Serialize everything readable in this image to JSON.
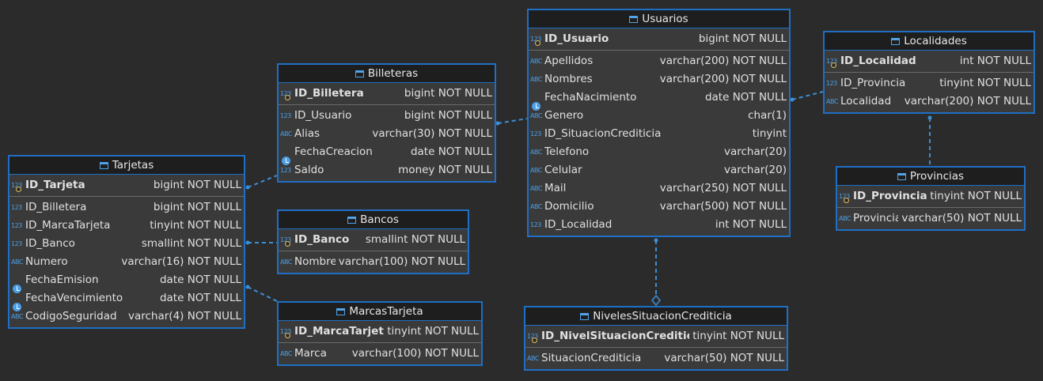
{
  "entities": {
    "usuarios": {
      "title": "Usuarios",
      "pk": {
        "name": "ID_Usuario",
        "type": "bigint NOT NULL",
        "icon": "123"
      },
      "columns": [
        {
          "name": "Apellidos",
          "type": "varchar(200) NOT NULL",
          "icon": "ABC"
        },
        {
          "name": "Nombres",
          "type": "varchar(200) NOT NULL",
          "icon": "ABC"
        },
        {
          "name": "FechaNacimiento",
          "type": "date NOT NULL",
          "icon": "date"
        },
        {
          "name": "Genero",
          "type": "char(1)",
          "icon": "ABC"
        },
        {
          "name": "ID_SituacionCrediticia",
          "type": "tinyint",
          "icon": "123"
        },
        {
          "name": "Telefono",
          "type": "varchar(20)",
          "icon": "ABC"
        },
        {
          "name": "Celular",
          "type": "varchar(20)",
          "icon": "ABC"
        },
        {
          "name": "Mail",
          "type": "varchar(250) NOT NULL",
          "icon": "ABC"
        },
        {
          "name": "Domicilio",
          "type": "varchar(500) NOT NULL",
          "icon": "ABC"
        },
        {
          "name": "ID_Localidad",
          "type": "int NOT NULL",
          "icon": "123"
        }
      ]
    },
    "localidades": {
      "title": "Localidades",
      "pk": {
        "name": "ID_Localidad",
        "type": "int NOT NULL",
        "icon": "123"
      },
      "columns": [
        {
          "name": "ID_Provincia",
          "type": "tinyint NOT NULL",
          "icon": "123"
        },
        {
          "name": "Localidad",
          "type": "varchar(200) NOT NULL",
          "icon": "ABC"
        }
      ]
    },
    "provincias": {
      "title": "Provincias",
      "pk": {
        "name": "ID_Provincia",
        "type": "tinyint NOT NULL",
        "icon": "123"
      },
      "columns": [
        {
          "name": "Provincia",
          "type": "varchar(50) NOT NULL",
          "icon": "ABC"
        }
      ]
    },
    "billeteras": {
      "title": "Billeteras",
      "pk": {
        "name": "ID_Billetera",
        "type": "bigint NOT NULL",
        "icon": "123"
      },
      "columns": [
        {
          "name": "ID_Usuario",
          "type": "bigint NOT NULL",
          "icon": "123"
        },
        {
          "name": "Alias",
          "type": "varchar(30) NOT NULL",
          "icon": "ABC"
        },
        {
          "name": "FechaCreacion",
          "type": "date NOT NULL",
          "icon": "date"
        },
        {
          "name": "Saldo",
          "type": "money NOT NULL",
          "icon": "123"
        }
      ]
    },
    "tarjetas": {
      "title": "Tarjetas",
      "pk": {
        "name": "ID_Tarjeta",
        "type": "bigint NOT NULL",
        "icon": "123"
      },
      "columns": [
        {
          "name": "ID_Billetera",
          "type": "bigint NOT NULL",
          "icon": "123"
        },
        {
          "name": "ID_MarcaTarjeta",
          "type": "tinyint NOT NULL",
          "icon": "123"
        },
        {
          "name": "ID_Banco",
          "type": "smallint NOT NULL",
          "icon": "123"
        },
        {
          "name": "Numero",
          "type": "varchar(16) NOT NULL",
          "icon": "ABC"
        },
        {
          "name": "FechaEmision",
          "type": "date NOT NULL",
          "icon": "date"
        },
        {
          "name": "FechaVencimiento",
          "type": "date NOT NULL",
          "icon": "date"
        },
        {
          "name": "CodigoSeguridad",
          "type": "varchar(4) NOT NULL",
          "icon": "ABC"
        }
      ]
    },
    "bancos": {
      "title": "Bancos",
      "pk": {
        "name": "ID_Banco",
        "type": "smallint NOT NULL",
        "icon": "123"
      },
      "columns": [
        {
          "name": "Nombre",
          "type": "varchar(100) NOT NULL",
          "icon": "ABC"
        }
      ]
    },
    "marcas": {
      "title": "MarcasTarjeta",
      "pk": {
        "name": "ID_MarcaTarjeta",
        "type": "tinyint NOT NULL",
        "icon": "123"
      },
      "columns": [
        {
          "name": "Marca",
          "type": "varchar(100) NOT NULL",
          "icon": "ABC"
        }
      ]
    },
    "niveles": {
      "title": "NivelesSituacionCrediticia",
      "pk": {
        "name": "ID_NivelSituacionCrediticia",
        "type": "tinyint NOT NULL",
        "icon": "123"
      },
      "columns": [
        {
          "name": "SituacionCrediticia",
          "type": "varchar(50) NOT NULL",
          "icon": "ABC"
        }
      ]
    }
  },
  "colors": {
    "background": "#2b2b2b",
    "entity_border": "#1f6fc4",
    "relationship_line": "#3d8fd6"
  }
}
